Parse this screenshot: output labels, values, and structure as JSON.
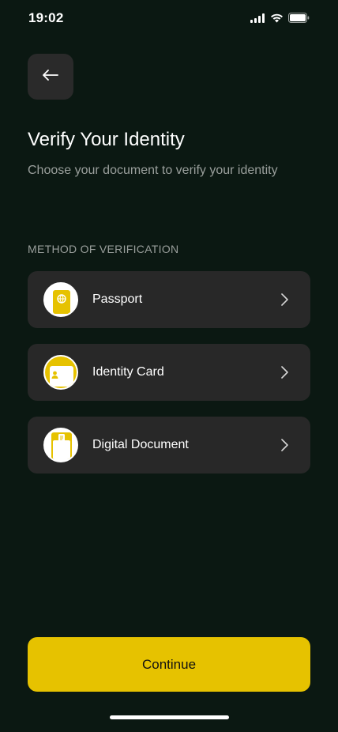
{
  "status_bar": {
    "time": "19:02",
    "icons": [
      "signal-icon",
      "wifi-icon",
      "battery-icon"
    ]
  },
  "header": {
    "back_icon": "arrow-left-icon",
    "title": "Verify Your Identity",
    "subtitle": "Choose your document to verify your identity"
  },
  "methods": {
    "section_label": "METHOD OF VERIFICATION",
    "items": [
      {
        "label": "Passport",
        "icon": "passport-icon"
      },
      {
        "label": "Identity Card",
        "icon": "id-card-icon"
      },
      {
        "label": "Digital Document",
        "icon": "document-icon"
      }
    ]
  },
  "footer": {
    "continue_label": "Continue"
  },
  "colors": {
    "background": "#0b1812",
    "card": "#282828",
    "accent": "#e6c200",
    "muted_text": "#9a9f9c"
  }
}
